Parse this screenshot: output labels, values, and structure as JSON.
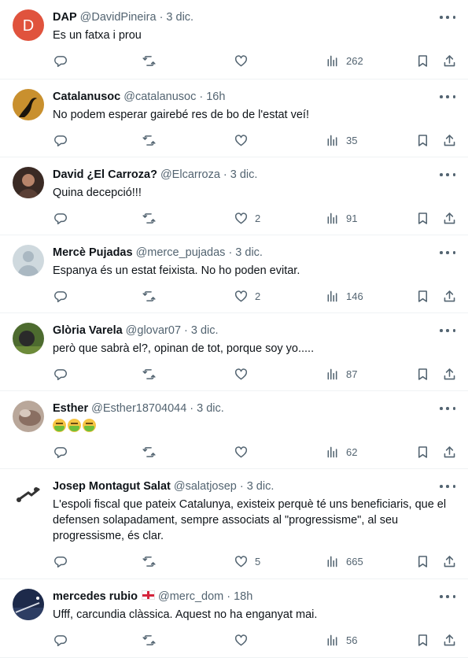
{
  "tweets": [
    {
      "name": "DAP",
      "handle": "@DavidPineira",
      "time": "3 dic.",
      "text": "Es un fatxa i prou",
      "avatar": {
        "kind": "letter",
        "letter": "D",
        "color": "#e0533d"
      },
      "replies": "",
      "retweets": "",
      "likes": "",
      "views": "262"
    },
    {
      "name": "Catalanusoc",
      "handle": "@catalanusoc",
      "time": "16h",
      "text": "No podem esperar gairebé res de bo de l'estat veí!",
      "avatar": {
        "kind": "photo",
        "bg": "#c9902e",
        "fg": "#1b140c"
      },
      "replies": "",
      "retweets": "",
      "likes": "",
      "views": "35"
    },
    {
      "name": "David ¿El Carroza?",
      "handle": "@Elcarroza",
      "time": "3 dic.",
      "text": "Quina decepció!!!",
      "avatar": {
        "kind": "photo",
        "bg": "#3a2a24",
        "fg": "#b7846a"
      },
      "replies": "",
      "retweets": "",
      "likes": "2",
      "views": "91"
    },
    {
      "name": "Mercè Pujadas",
      "handle": "@merce_pujadas",
      "time": "3 dic.",
      "text": "Espanya és un estat feixista.  No ho poden evitar.",
      "avatar": {
        "kind": "default",
        "bg": "#cfd9de",
        "fg": "#ffffff"
      },
      "replies": "",
      "retweets": "",
      "likes": "2",
      "views": "146"
    },
    {
      "name": "Glòria Varela",
      "handle": "@glovar07",
      "time": "3 dic.",
      "text": "però que sabrà el?, opinan de tot, porque soy yo.....",
      "avatar": {
        "kind": "photo",
        "bg": "#4d6b2f",
        "fg": "#2a2a2a"
      },
      "replies": "",
      "retweets": "",
      "likes": "",
      "views": "87"
    },
    {
      "name": "Esther",
      "handle": "@Esther18704044",
      "time": "3 dic.",
      "text": "",
      "emoji_count": 3,
      "avatar": {
        "kind": "photo",
        "bg": "#b9a79a",
        "fg": "#8a6f62"
      },
      "replies": "",
      "retweets": "",
      "likes": "",
      "views": "62"
    },
    {
      "name": "Josep Montagut Salat",
      "handle": "@salatjosep",
      "time": "3 dic.",
      "text": "L'espoli fiscal que pateix Catalunya, existeix perquè té uns beneficiaris, que el defensen solapadament, sempre associats al \"progressisme\", al seu progressisme, és clar.",
      "avatar": {
        "kind": "photo",
        "bg": "#ffffff",
        "fg": "#333333"
      },
      "replies": "",
      "retweets": "",
      "likes": "5",
      "views": "665"
    },
    {
      "name": "mercedes rubio",
      "handle": "@merc_dom",
      "time": "18h",
      "text": "Ufff, carcundia clàssica. Aquest no ha enganyat mai.",
      "flag": true,
      "avatar": {
        "kind": "photo",
        "bg": "#1d2a4a",
        "fg": "#d9dde6"
      },
      "replies": "",
      "retweets": "",
      "likes": "",
      "views": "56"
    }
  ],
  "icons": {
    "reply": "reply-icon",
    "retweet": "retweet-icon",
    "like": "heart-icon",
    "views": "views-icon",
    "bookmark": "bookmark-icon",
    "share": "share-icon",
    "more": "more-icon"
  },
  "colors": {
    "text": "#0f1419",
    "secondary": "#536471",
    "divider": "#eff3f4"
  }
}
